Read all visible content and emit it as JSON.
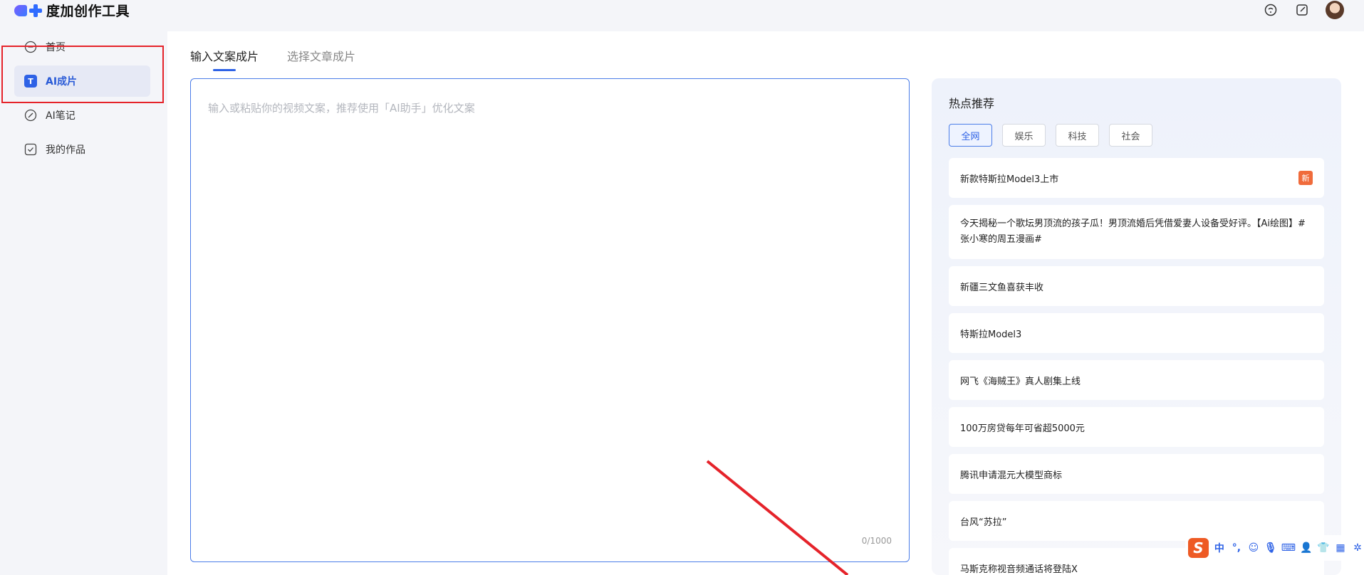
{
  "app": {
    "title": "度加创作工具"
  },
  "sidebar": {
    "items": [
      {
        "label": "首页",
        "icon": "home-icon"
      },
      {
        "label": "AI成片",
        "icon": "t-icon",
        "active": true,
        "icon_text": "T"
      },
      {
        "label": "AI笔记",
        "icon": "pen-icon"
      },
      {
        "label": "我的作品",
        "icon": "check-icon"
      }
    ]
  },
  "tabs": [
    {
      "label": "输入文案成片",
      "active": true
    },
    {
      "label": "选择文章成片",
      "active": false
    }
  ],
  "editor": {
    "placeholder": "输入或粘贴你的视频文案，推荐使用「AI助手」优化文案",
    "value": "",
    "counter": "0/1000"
  },
  "hot": {
    "title": "热点推荐",
    "tabs": [
      {
        "label": "全网",
        "active": true
      },
      {
        "label": "娱乐",
        "active": false
      },
      {
        "label": "科技",
        "active": false
      },
      {
        "label": "社会",
        "active": false
      }
    ],
    "items": [
      {
        "text": "新款特斯拉Model3上市",
        "badge": "新"
      },
      {
        "text": "今天揭秘一个歌坛男顶流的孩子瓜！男顶流婚后凭借爱妻人设备受好评。【Ai绘图】#张小寒的周五漫画#"
      },
      {
        "text": "新疆三文鱼喜获丰收"
      },
      {
        "text": "特斯拉Model3"
      },
      {
        "text": "网飞《海贼王》真人剧集上线"
      },
      {
        "text": "100万房贷每年可省超5000元"
      },
      {
        "text": "腾讯申请混元大模型商标"
      },
      {
        "text": "台风“苏拉”"
      },
      {
        "text": "马斯克称视音频通话将登陆X"
      }
    ]
  },
  "ime": {
    "logo": "S",
    "lang": "中"
  },
  "colors": {
    "accent": "#2e62e6",
    "highlight": "#e5232a",
    "badge": "#f06b3b"
  }
}
